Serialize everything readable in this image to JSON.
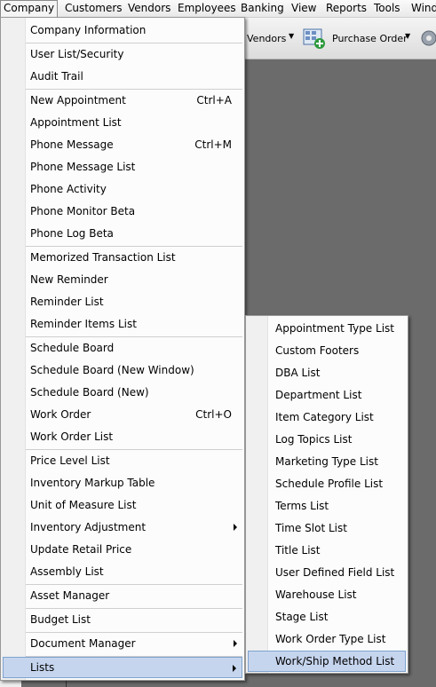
{
  "menubar": {
    "items": [
      "Company",
      "Customers",
      "Vendors",
      "Employees",
      "Banking",
      "View",
      "Reports",
      "Tools",
      "Wind"
    ]
  },
  "toolbar": {
    "vendors_label": "Vendors",
    "purchase_order_label": "Purchase Order"
  },
  "company_menu": {
    "items": [
      {
        "label": "Company Information",
        "shortcut": ""
      },
      {
        "label": "User List/Security",
        "shortcut": ""
      },
      {
        "label": "Audit Trail",
        "shortcut": ""
      },
      {
        "label": "New Appointment",
        "shortcut": "Ctrl+A"
      },
      {
        "label": "Appointment List",
        "shortcut": ""
      },
      {
        "label": "Phone Message",
        "shortcut": "Ctrl+M"
      },
      {
        "label": "Phone Message List",
        "shortcut": ""
      },
      {
        "label": "Phone Activity",
        "shortcut": ""
      },
      {
        "label": "Phone Monitor Beta",
        "shortcut": ""
      },
      {
        "label": "Phone Log Beta",
        "shortcut": ""
      },
      {
        "label": "Memorized Transaction List",
        "shortcut": ""
      },
      {
        "label": "New Reminder",
        "shortcut": ""
      },
      {
        "label": "Reminder List",
        "shortcut": ""
      },
      {
        "label": "Reminder Items List",
        "shortcut": ""
      },
      {
        "label": "Schedule Board",
        "shortcut": ""
      },
      {
        "label": "Schedule Board (New Window)",
        "shortcut": ""
      },
      {
        "label": "Schedule Board (New)",
        "shortcut": ""
      },
      {
        "label": "Work Order",
        "shortcut": "Ctrl+O"
      },
      {
        "label": "Work Order List",
        "shortcut": ""
      },
      {
        "label": "Price Level List",
        "shortcut": ""
      },
      {
        "label": "Inventory Markup Table",
        "shortcut": ""
      },
      {
        "label": "Unit of Measure List",
        "shortcut": ""
      },
      {
        "label": "Inventory Adjustment",
        "shortcut": ""
      },
      {
        "label": "Update Retail Price",
        "shortcut": ""
      },
      {
        "label": "Assembly List",
        "shortcut": ""
      },
      {
        "label": "Asset Manager",
        "shortcut": ""
      },
      {
        "label": "Budget List",
        "shortcut": ""
      },
      {
        "label": "Document Manager",
        "shortcut": ""
      },
      {
        "label": "Lists",
        "shortcut": ""
      }
    ]
  },
  "lists_menu": {
    "items": [
      "Appointment Type List",
      "Custom Footers",
      "DBA List",
      "Department List",
      "Item Category List",
      "Log Topics List",
      "Marketing Type List",
      "Schedule Profile List",
      "Terms List",
      "Time Slot List",
      "Title List",
      "User Defined Field List",
      "Warehouse List",
      "Stage List",
      "Work Order Type List",
      "Work/Ship Method List"
    ]
  }
}
